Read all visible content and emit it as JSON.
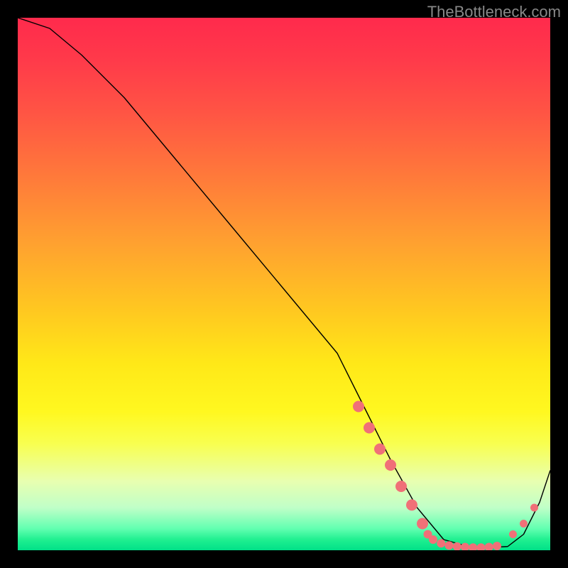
{
  "attribution": "TheBottleneck.com",
  "chart_data": {
    "type": "line",
    "title": "",
    "xlabel": "",
    "ylabel": "",
    "xlim": [
      0,
      100
    ],
    "ylim": [
      0,
      100
    ],
    "grid": false,
    "legend": false,
    "series": [
      {
        "name": "curve",
        "x": [
          0,
          6,
          12,
          20,
          30,
          40,
          50,
          60,
          63,
          66,
          70,
          75,
          80,
          85,
          88,
          92,
          95,
          98,
          100
        ],
        "y": [
          100,
          98,
          93,
          85,
          73,
          61,
          49,
          37,
          31,
          25,
          17,
          8,
          2,
          0.6,
          0.5,
          0.7,
          3,
          9,
          15
        ]
      }
    ],
    "markers": [
      {
        "name": "thick-left-start",
        "x": 64,
        "y": 27
      },
      {
        "name": "thick-left-2",
        "x": 66,
        "y": 23
      },
      {
        "name": "thick-left-3",
        "x": 68,
        "y": 19
      },
      {
        "name": "thick-left-4",
        "x": 70,
        "y": 16
      },
      {
        "name": "thick-left-5",
        "x": 72,
        "y": 12
      },
      {
        "name": "thick-left-6",
        "x": 74,
        "y": 8.5
      },
      {
        "name": "thick-left-7",
        "x": 76,
        "y": 5
      },
      {
        "name": "bottom-1",
        "x": 77,
        "y": 3
      },
      {
        "name": "bottom-2",
        "x": 78,
        "y": 2
      },
      {
        "name": "bottom-3",
        "x": 79.5,
        "y": 1.3
      },
      {
        "name": "bottom-4",
        "x": 81,
        "y": 0.9
      },
      {
        "name": "bottom-5",
        "x": 82.5,
        "y": 0.7
      },
      {
        "name": "bottom-6",
        "x": 84,
        "y": 0.6
      },
      {
        "name": "bottom-7",
        "x": 85.5,
        "y": 0.5
      },
      {
        "name": "bottom-8",
        "x": 87,
        "y": 0.5
      },
      {
        "name": "bottom-9",
        "x": 88.5,
        "y": 0.6
      },
      {
        "name": "bottom-10",
        "x": 90,
        "y": 0.8
      },
      {
        "name": "right-ascent-1",
        "x": 93,
        "y": 3
      },
      {
        "name": "right-ascent-2",
        "x": 95,
        "y": 5
      },
      {
        "name": "right-ascent-3",
        "x": 97,
        "y": 8
      }
    ],
    "gradient_stops": [
      {
        "pos": 0,
        "color": "#ff2a4c"
      },
      {
        "pos": 18,
        "color": "#ff5544"
      },
      {
        "pos": 42,
        "color": "#ffa030"
      },
      {
        "pos": 65,
        "color": "#ffe818"
      },
      {
        "pos": 87,
        "color": "#e8ffb0"
      },
      {
        "pos": 100,
        "color": "#00e088"
      }
    ]
  }
}
